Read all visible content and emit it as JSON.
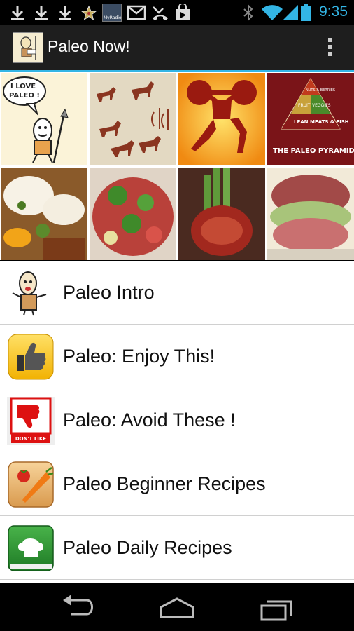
{
  "status_bar": {
    "time": "9:35",
    "icons": [
      "download-icon",
      "download-icon",
      "download-icon",
      "star-icon",
      "myradio-icon",
      "gmail-icon",
      "missed-call-icon",
      "play-store-icon",
      "bluetooth-icon",
      "wifi-icon",
      "signal-icon",
      "battery-icon"
    ],
    "radio_label": "MyRadio",
    "accent_color": "#33b5e5"
  },
  "action_bar": {
    "title": "Paleo Now!",
    "background": "#1e1e1e",
    "overflow_menu_icon": "overflow-menu-icon"
  },
  "banner": {
    "tiles": [
      {
        "label": "I LOVE PALEO!"
      },
      {
        "label": "cave-painting"
      },
      {
        "label": "weightlifter"
      },
      {
        "label": "THE PALEO PYRAMID",
        "pyramid": [
          "NUTS & BERRIES",
          "FRUIT",
          "VEGGIES",
          "LEAN MEATS & FISH"
        ]
      },
      {
        "label": "eggs-dish"
      },
      {
        "label": "salad-dish"
      },
      {
        "label": "asparagus-bacon-dish"
      },
      {
        "label": "corned-beef-dish"
      }
    ]
  },
  "menu": {
    "items": [
      {
        "label": "Paleo Intro",
        "icon": "caveman-icon"
      },
      {
        "label": "Paleo: Enjoy This!",
        "icon": "thumbs-up-icon"
      },
      {
        "label": "Paleo: Avoid These !",
        "icon": "thumbs-down-icon",
        "icon_caption": "DON'T LIKE"
      },
      {
        "label": "Paleo Beginner Recipes",
        "icon": "carrot-tomato-icon"
      },
      {
        "label": "Paleo Daily Recipes",
        "icon": "chef-book-icon"
      }
    ]
  },
  "nav_bar": {
    "icons": [
      "back-icon",
      "home-icon",
      "recent-apps-icon"
    ]
  }
}
